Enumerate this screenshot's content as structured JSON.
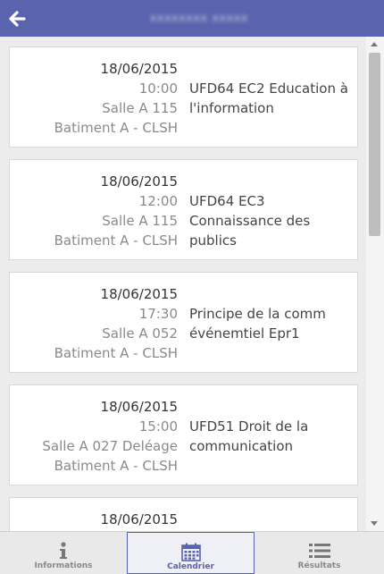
{
  "header": {
    "title": "xxxxxxxx xxxxx",
    "back_icon": "arrow-left-icon",
    "bg_color": "#5a63ad"
  },
  "sessions": [
    {
      "date": "18/06/2015",
      "time": "10:00",
      "room": "Salle A 115",
      "building": "Batiment A - CLSH",
      "course_lines": [
        "UFD64 EC2 Education à",
        "l'information"
      ]
    },
    {
      "date": "18/06/2015",
      "time": "12:00",
      "room": "Salle A 115",
      "building": "Batiment A - CLSH",
      "course_lines": [
        "UFD64 EC3",
        "Connaissance des",
        "publics"
      ]
    },
    {
      "date": "18/06/2015",
      "time": "17:30",
      "room": "Salle A 052",
      "building": "Batiment A - CLSH",
      "course_lines": [
        "Principe de la comm",
        "événemtiel Epr1"
      ]
    },
    {
      "date": "18/06/2015",
      "time": "15:00",
      "room": "Salle A 027 Deléage",
      "building": "Batiment A - CLSH",
      "course_lines": [
        "UFD51 Droit de la",
        "communication"
      ]
    },
    {
      "date": "18/06/2015"
    }
  ],
  "tabs": [
    {
      "label": "Informations",
      "icon": "info-icon",
      "active": false
    },
    {
      "label": "Calendrier",
      "icon": "calendar-icon",
      "active": true
    },
    {
      "label": "Résultats",
      "icon": "list-icon",
      "active": false
    }
  ],
  "scrollbar": {
    "thumb_color": "#bdbdbd"
  }
}
